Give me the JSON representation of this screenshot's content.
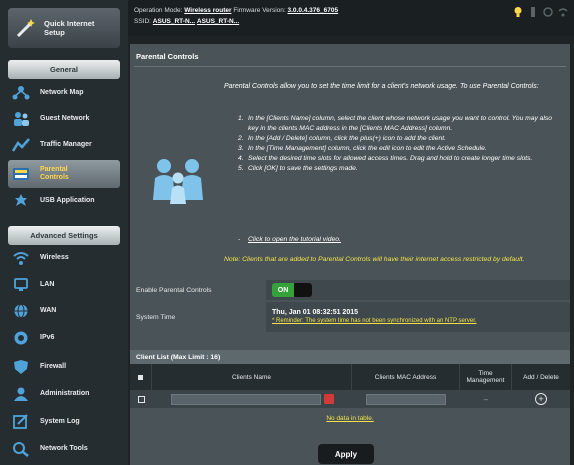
{
  "sidebar": {
    "quick_setup": "Quick Internet Setup",
    "general_header": "General",
    "general_items": [
      {
        "label": "Network Map",
        "icon": "network-map-icon"
      },
      {
        "label": "Guest Network",
        "icon": "guest-network-icon"
      },
      {
        "label": "Traffic Manager",
        "icon": "traffic-manager-icon"
      },
      {
        "label": "Parental Controls",
        "icon": "parental-controls-icon",
        "active": true
      },
      {
        "label": "USB Application",
        "icon": "usb-application-icon"
      }
    ],
    "advanced_header": "Advanced Settings",
    "advanced_items": [
      {
        "label": "Wireless",
        "icon": "wireless-icon"
      },
      {
        "label": "LAN",
        "icon": "lan-icon"
      },
      {
        "label": "WAN",
        "icon": "wan-icon"
      },
      {
        "label": "IPv6",
        "icon": "ipv6-icon"
      },
      {
        "label": "Firewall",
        "icon": "firewall-icon"
      },
      {
        "label": "Administration",
        "icon": "administration-icon"
      },
      {
        "label": "System Log",
        "icon": "system-log-icon"
      },
      {
        "label": "Network Tools",
        "icon": "network-tools-icon"
      }
    ]
  },
  "topbar": {
    "mode_label": "Operation Mode:",
    "mode_value": "Wireless router",
    "firmware_label": "Firmware Version:",
    "firmware_value": "3.0.0.4.376_6705",
    "ssid_label": "SSID:",
    "ssid_1": "ASUS_RT-N...",
    "ssid_2": "ASUS_RT-N..."
  },
  "main": {
    "title": "Parental Controls",
    "intro": "Parental Controls allow you to set the time limit for a client's network usage. To use Parental Controls:",
    "steps": [
      {
        "n": "1.",
        "text": "In the [Clients Name] column, select the client whose network usage you want to control. You may also key in the clients MAC address in the [Clients MAC Address] column."
      },
      {
        "n": "2.",
        "text": "In the [Add / Delete] column, click the plus(+) icon to add the client."
      },
      {
        "n": "3.",
        "text": "In the [Time Management] column, click the edit icon to edit the Active Schedule."
      },
      {
        "n": "4.",
        "text": "Select the desired time slots for allowed access times. Drag and hold to create longer time slots."
      },
      {
        "n": "5.",
        "text": "Click [OK] to save the settings made."
      }
    ],
    "tutorial": "Click to open the tutorial video.",
    "note": "Note: Clients that are added to Parental Controls will have their internet access restricted by default."
  },
  "settings": {
    "enable_label": "Enable Parental Controls",
    "toggle_on": "ON",
    "system_time_label": "System Time",
    "system_time_value": "Thu, Jan 01 08:32:51 2015",
    "system_time_warning": "* Reminder: The system time has not been synchronized with an NTP server."
  },
  "client_list": {
    "title": "Client List (Max Limit : 16)",
    "headers": [
      "",
      "Clients Name",
      "Clients MAC Address",
      "Time Management",
      "Add / Delete"
    ],
    "no_data": "No data in table."
  },
  "apply_label": "Apply",
  "colors": {
    "active_text": "#ffd84a",
    "toggle_on": "#35a13a",
    "note": "#f2e24a"
  }
}
